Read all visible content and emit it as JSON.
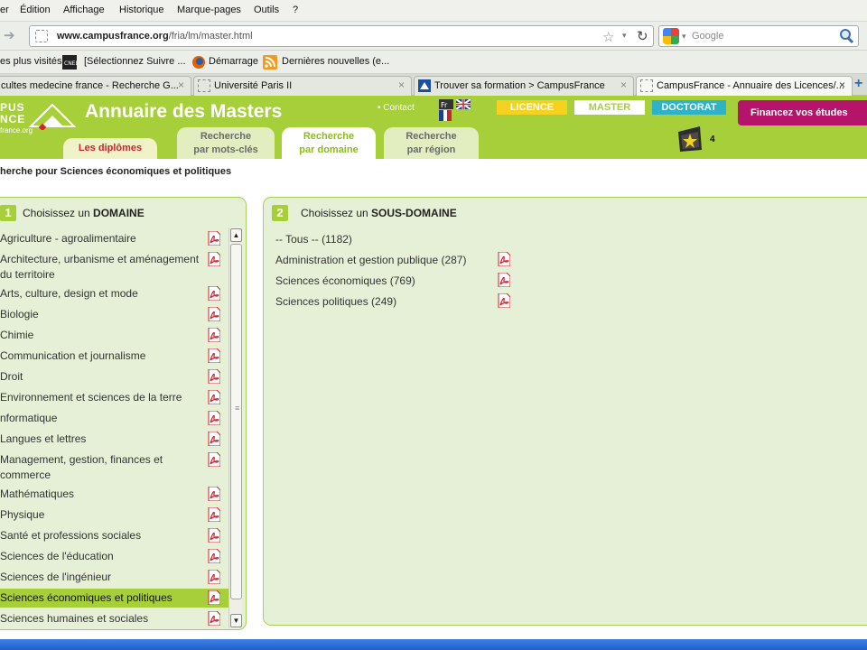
{
  "browser": {
    "menu": [
      "er",
      "Édition",
      "Affichage",
      "Historique",
      "Marque-pages",
      "Outils",
      "?"
    ],
    "url_host": "www.campusfrance.org",
    "url_path": "/fria/lm/master.html",
    "search_placeholder": "Google",
    "bookmarks": [
      "es plus visités",
      "[Sélectionnez Suivre ...",
      "Démarrage",
      "Dernières nouvelles (e..."
    ],
    "tabs": [
      {
        "label": "cultes medecine france - Recherche G..."
      },
      {
        "label": "Université Paris II"
      },
      {
        "label": "Trouver sa formation > CampusFrance"
      },
      {
        "label": "CampusFrance - Annuaire des Licences/..."
      }
    ],
    "tab_close": "×",
    "new_tab": "+"
  },
  "header": {
    "logo_line1": "PUS",
    "logo_line2": "NCE",
    "logo_small": "france.org",
    "title": "Annuaire des Masters",
    "contact": "• Contact",
    "flag_fr": "Fr",
    "levels": [
      "LICENCE",
      "MASTER",
      "DOCTORAT"
    ],
    "funding": "Financez vos études",
    "cart_count": "4",
    "tabs": {
      "diplomes": "Les diplômes",
      "motscles": [
        "Recherche",
        "par mots-clés"
      ],
      "domaine": [
        "Recherche",
        "par domaine"
      ],
      "region": [
        "Recherche",
        "par région"
      ]
    }
  },
  "breadcrumb": "herche pour Sciences économiques et politiques",
  "domaine_panel": {
    "num": "1",
    "title_prefix": "Choisissez un ",
    "title_bold": "DOMAINE",
    "items": [
      {
        "label": "Agriculture - agroalimentaire"
      },
      {
        "label": "Architecture, urbanisme et aménagement du territoire"
      },
      {
        "label": "Arts, culture, design et mode"
      },
      {
        "label": "Biologie"
      },
      {
        "label": "Chimie"
      },
      {
        "label": "Communication et journalisme"
      },
      {
        "label": "Droit"
      },
      {
        "label": "Environnement et sciences de la terre"
      },
      {
        "label": "nformatique"
      },
      {
        "label": "Langues et lettres"
      },
      {
        "label": "Management, gestion, finances et commerce"
      },
      {
        "label": "Mathématiques"
      },
      {
        "label": "Physique"
      },
      {
        "label": "Santé et professions sociales"
      },
      {
        "label": "Sciences de l'éducation"
      },
      {
        "label": "Sciences de l'ingénieur"
      },
      {
        "label": "Sciences économiques et politiques"
      },
      {
        "label": "Sciences humaines et sociales"
      }
    ],
    "selected": "Sciences économiques et politiques"
  },
  "sousdomaine_panel": {
    "num": "2",
    "title_prefix": "Choisissez un ",
    "title_bold": "SOUS-DOMAINE",
    "items": [
      {
        "label": "-- Tous -- (1182)"
      },
      {
        "label": "Administration et gestion publique (287)"
      },
      {
        "label": "Sciences économiques (769)"
      },
      {
        "label": "Sciences politiques (249)"
      }
    ]
  },
  "colors": {
    "brand_green": "#a6cf3a",
    "panel_bg": "#e6f0d6",
    "licence": "#f5d220",
    "master": "#ffffff",
    "doctorat": "#2db2c6",
    "funding": "#b6136b",
    "tab_red": "#c8262e"
  },
  "icons": [
    "back-icon",
    "forward-icon",
    "star-icon",
    "reload-icon",
    "google-icon",
    "search-icon",
    "rss-icon",
    "firefox-icon",
    "pdf-icon",
    "cart-icon",
    "flag-fr-icon",
    "flag-uk-icon"
  ]
}
